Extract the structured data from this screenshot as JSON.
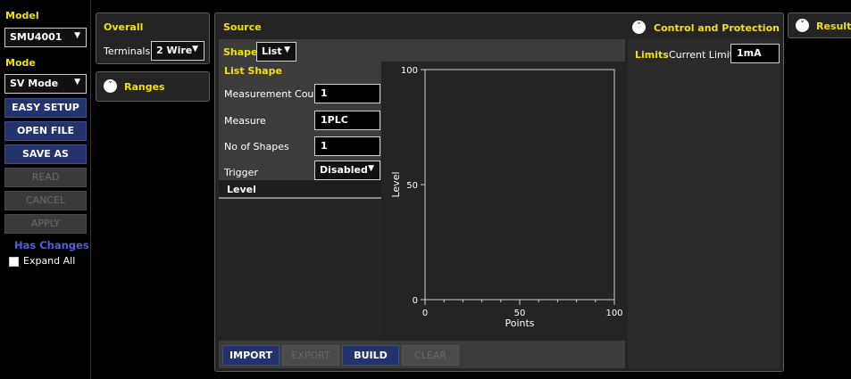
{
  "sidebar": {
    "model_label": "Model",
    "model_value": "SMU4001",
    "mode_label": "Mode",
    "mode_value": "SV Mode",
    "buttons": [
      {
        "label": "EASY SETUP"
      },
      {
        "label": "OPEN FILE"
      },
      {
        "label": "SAVE AS"
      },
      {
        "label": "READ"
      },
      {
        "label": "CANCEL"
      },
      {
        "label": "APPLY"
      }
    ],
    "has_changes": "Has Changes",
    "expand_all": "Expand All"
  },
  "overall": {
    "title": "Overall",
    "terminals_label": "Terminals",
    "terminals_value": "2 Wire"
  },
  "ranges": {
    "title": "Ranges"
  },
  "source": {
    "title": "Source",
    "shape_label": "Shape",
    "shape_value": "List",
    "list_shape_title": "List Shape",
    "fields": {
      "measurement_count_label": "Measurement Count",
      "measurement_count_value": "1",
      "measure_label": "Measure",
      "measure_value": "1PLC",
      "no_of_shapes_label": "No of Shapes",
      "no_of_shapes_value": "1",
      "trigger_label": "Trigger",
      "trigger_value": "Disabled"
    },
    "level_header": "Level",
    "bottom_buttons": [
      {
        "label": "IMPORT"
      },
      {
        "label": "EXPORT"
      },
      {
        "label": "BUILD"
      },
      {
        "label": "CLEAR"
      }
    ]
  },
  "control": {
    "title": "Control and Protection",
    "limits_label": "Limits",
    "current_limit_label": "Current Limit",
    "current_limit_value": "1mA"
  },
  "results": {
    "title": "Results"
  },
  "chart_data": {
    "type": "line",
    "xlabel": "Points",
    "ylabel": "Level",
    "xlim": [
      0,
      100
    ],
    "ylim": [
      0,
      100
    ],
    "x_ticks": [
      "0",
      "50",
      "100"
    ],
    "y_ticks": [
      "0",
      "50",
      "100"
    ],
    "series": []
  },
  "colors": {
    "accent_yellow": "#f2e200",
    "button_blue": "#24336b",
    "has_changes_blue": "#4a63d8"
  }
}
